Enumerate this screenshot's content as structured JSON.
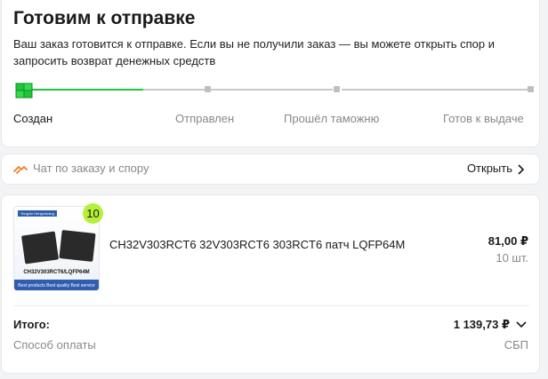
{
  "status": {
    "title": "Готовим к отправке",
    "description": "Ваш заказ готовится к отправке. Если вы не получили заказ — вы можете открыть спор и запросить возврат денежных средств",
    "steps": [
      {
        "label": "Создан",
        "active": true
      },
      {
        "label": "Отправлен",
        "active": false
      },
      {
        "label": "Прошёл таможню",
        "active": false
      },
      {
        "label": "Готов к выдаче",
        "active": false
      }
    ],
    "progress_fraction": 0.25,
    "colors": {
      "done": "#1fc53b",
      "pending": "#c9c9cc"
    }
  },
  "chat": {
    "label": "Чат по заказу и спору",
    "action": "Открыть"
  },
  "order": {
    "item": {
      "image_brand": "Yongxin Hengchuang",
      "image_model": "CH32V303RCT6/LQFP64M",
      "image_banner": "Best products Best quality Best service",
      "quantity_badge": "10",
      "name": "CH32V303RCT6 32V303RCT6 303RCT6 патч LQFP64M",
      "price": "81,00 ₽",
      "quantity": "10 шт."
    },
    "total_label": "Итого:",
    "total_value": "1 139,73 ₽",
    "payment_label": "Способ оплаты",
    "payment_value": "СБП",
    "colors": {
      "badge": "#b5f03a"
    }
  }
}
